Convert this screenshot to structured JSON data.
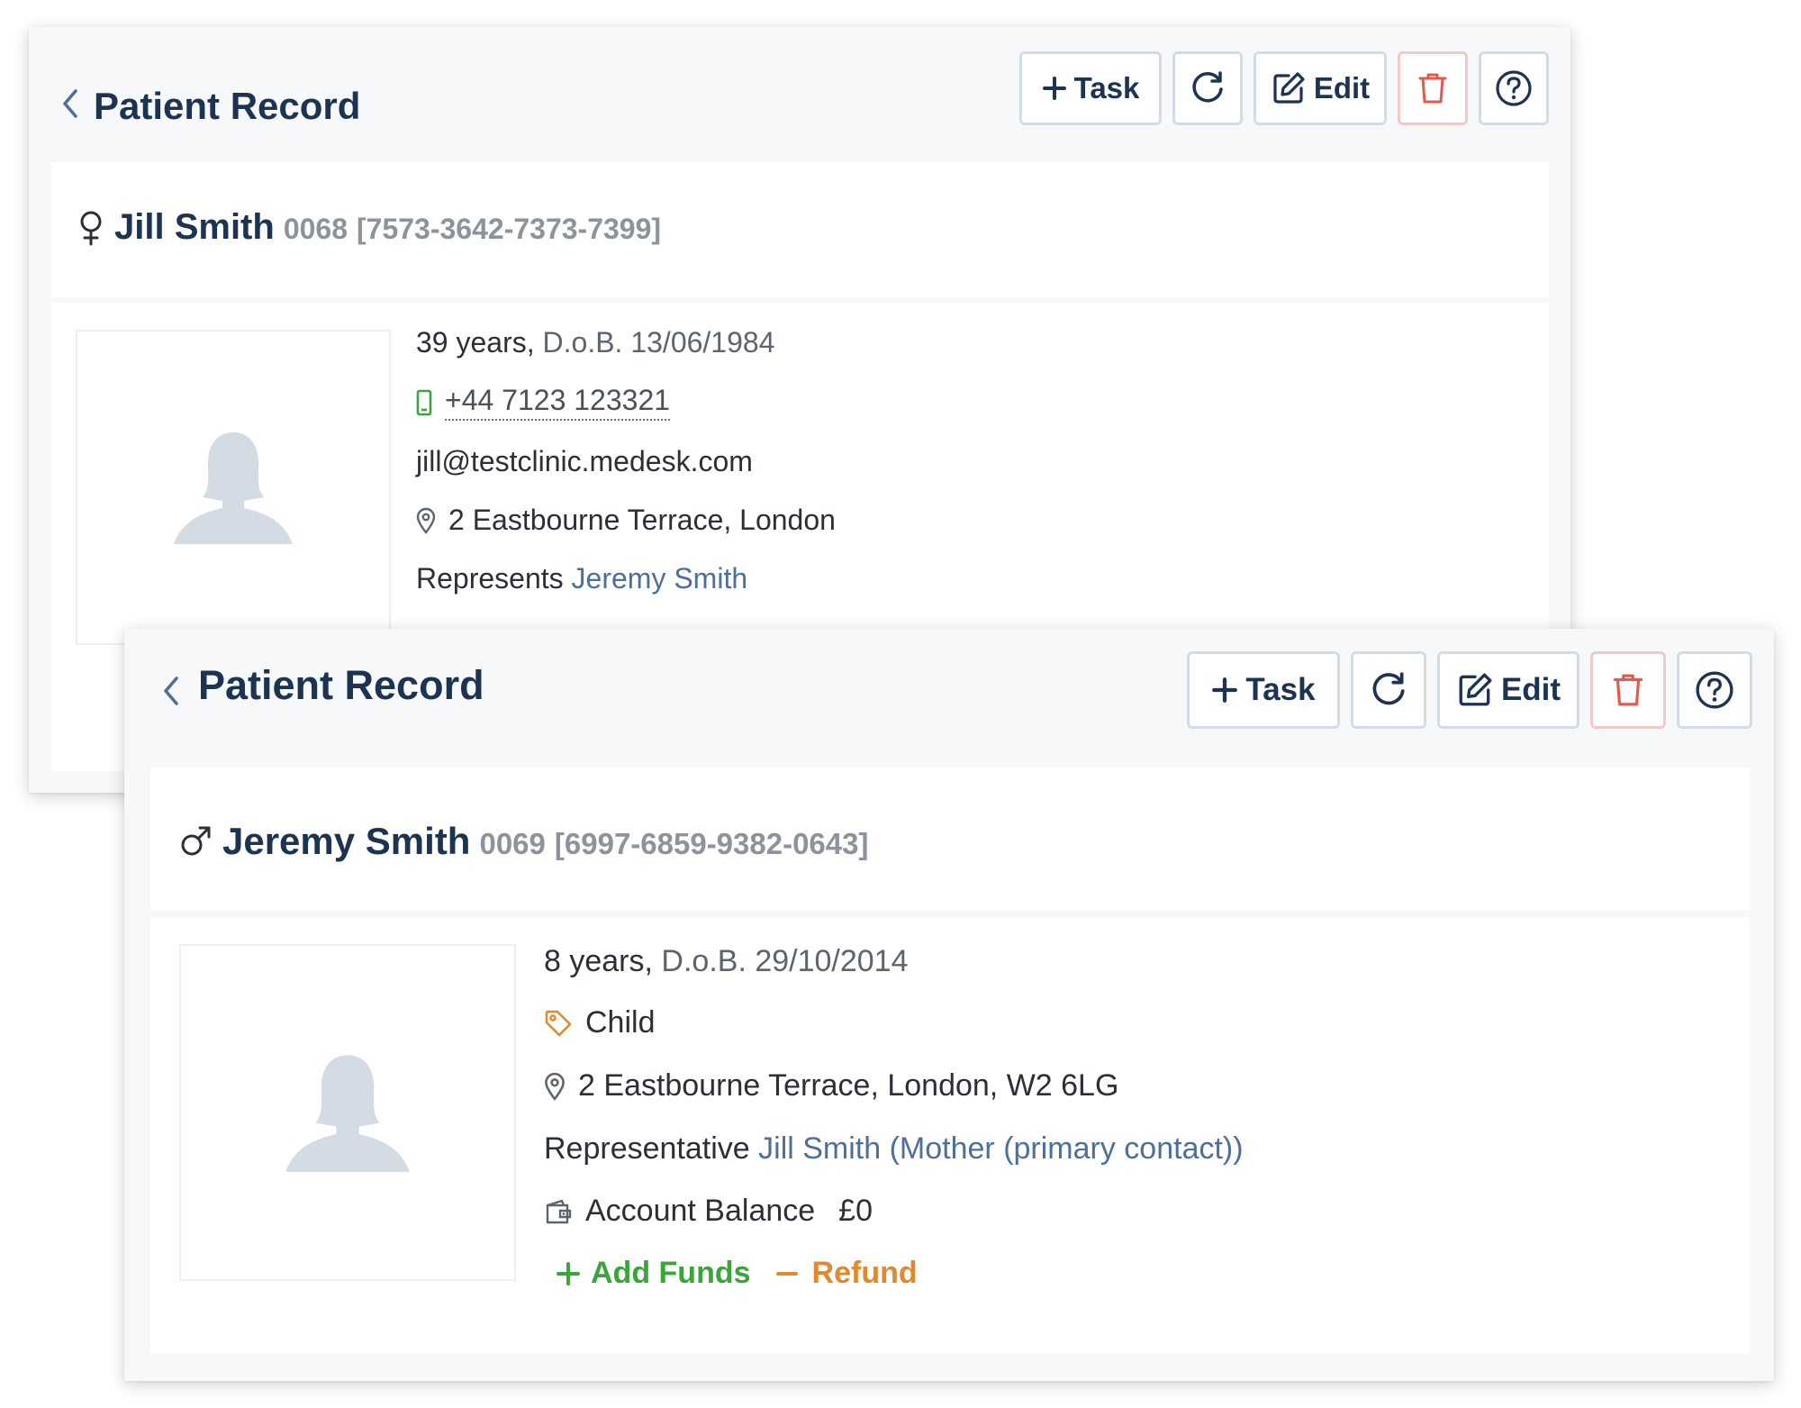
{
  "colors": {
    "navy": "#1c3352",
    "link": "#4d6f9a",
    "green": "#3aa53a",
    "orange": "#e08a2d",
    "red": "#e5584f",
    "border": "#d3dbe4"
  },
  "record_back": {
    "title": "Patient Record",
    "toolbar": {
      "task_label": "Task",
      "edit_label": "Edit",
      "icons": [
        "plus-icon",
        "refresh-icon",
        "edit-icon",
        "trash-icon",
        "help-icon"
      ]
    },
    "patient": {
      "gender_icon": "female-icon",
      "name": "Jill Smith",
      "number": "0068",
      "nhs": "[7573-3642-7373-7399]",
      "age": "39 years,",
      "dob": "D.o.B. 13/06/1984",
      "phone": "+44 7123 123321",
      "email": "jill@testclinic.medesk.com",
      "address": "2 Eastbourne Terrace, London",
      "represents_label": "Represents",
      "represents_name": "Jeremy Smith"
    }
  },
  "record_front": {
    "title": "Patient Record",
    "toolbar": {
      "task_label": "Task",
      "edit_label": "Edit",
      "icons": [
        "plus-icon",
        "refresh-icon",
        "edit-icon",
        "trash-icon",
        "help-icon"
      ]
    },
    "patient": {
      "gender_icon": "male-icon",
      "name": "Jeremy Smith",
      "number": "0069",
      "nhs": "[6997-6859-9382-0643]",
      "age": "8 years,",
      "dob": "D.o.B. 29/10/2014",
      "tag": "Child",
      "address": "2 Eastbourne Terrace, London, W2 6LG",
      "representative_label": "Representative",
      "representative_value": "Jill Smith (Mother (primary contact))",
      "balance_label": "Account Balance",
      "balance_value": "£0",
      "add_funds": "Add Funds",
      "refund": "Refund"
    }
  }
}
